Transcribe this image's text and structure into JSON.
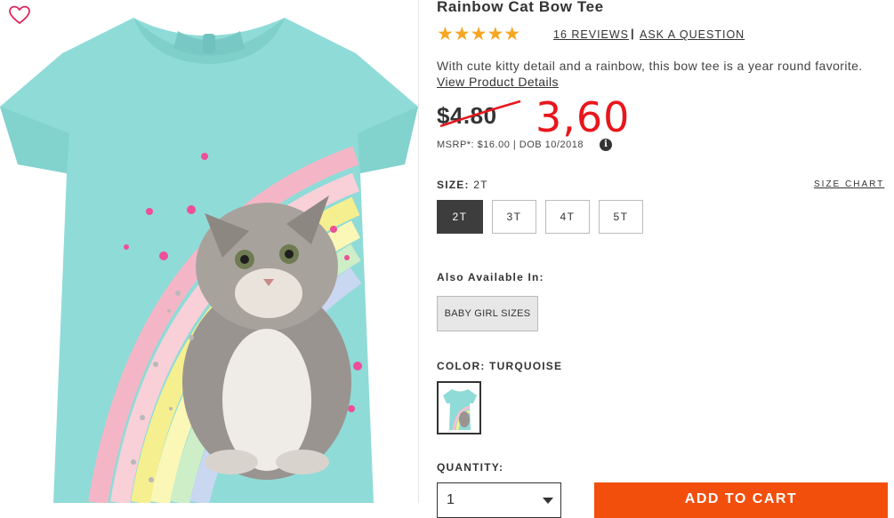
{
  "product": {
    "title": "Rainbow Cat Bow Tee",
    "rating_stars": "★★★★★",
    "reviews_link": "16 REVIEWS",
    "separator": "|",
    "ask_link": "ASK A QUESTION",
    "description": "With cute kitty detail and a rainbow, this bow tee is a year round favorite.",
    "details_link": "View Product Details",
    "price": "$4.80",
    "handwritten_price": "3,60",
    "msrp_text": "MSRP*: $16.00 | DOB 10/2018",
    "info_icon_glyph": "i"
  },
  "size": {
    "label": "SIZE:",
    "selected": "2T",
    "chart_link": "SIZE CHART",
    "options": [
      "2T",
      "3T",
      "4T",
      "5T"
    ]
  },
  "also_available": {
    "label": "Also Available In:",
    "button": "BABY GIRL SIZES"
  },
  "color": {
    "label": "COLOR: TURQUOISE",
    "swatch_color": "#8fdbd8"
  },
  "quantity": {
    "label": "QUANTITY:",
    "value": "1"
  },
  "cart_button": "ADD TO CART",
  "colors": {
    "shirt": "#8fdbd8",
    "accent_orange": "#f24f0d",
    "star": "#f5a623",
    "handwriting_red": "#e8161c"
  }
}
